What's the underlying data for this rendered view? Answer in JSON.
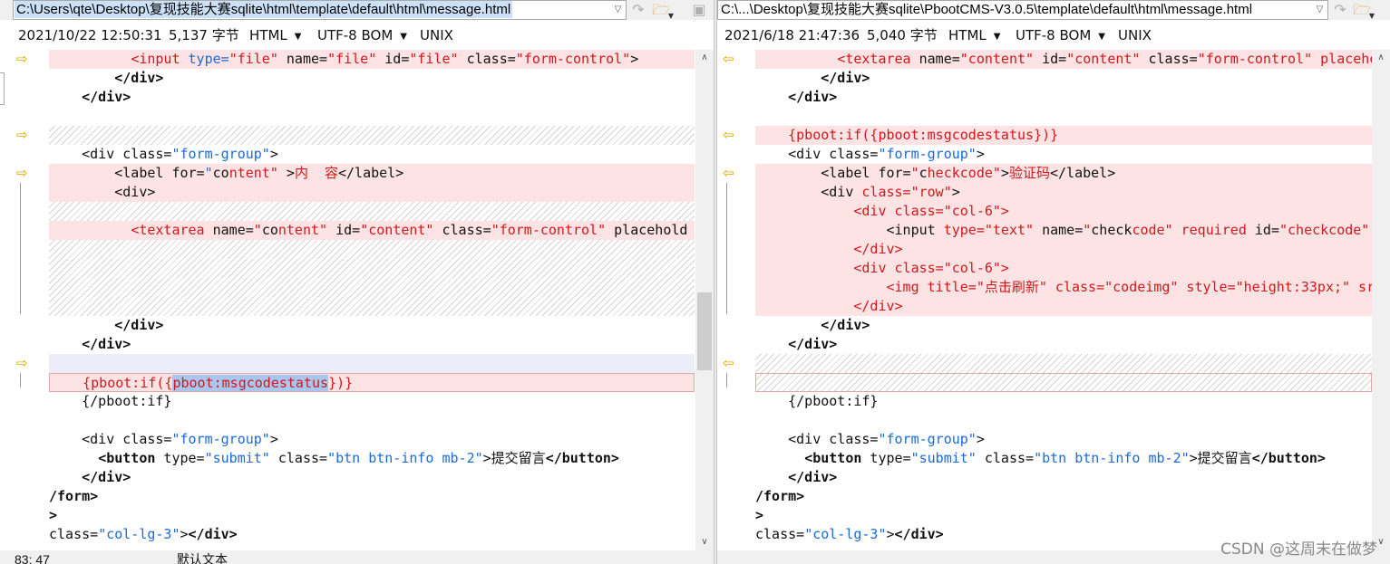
{
  "left": {
    "path": "C:\\Users\\qte\\Desktop\\复现技能大赛sqlite\\html\\template\\default\\html\\message.html",
    "info": {
      "timestamp": "2021/10/22 12:50:31",
      "size": "5,137 字节",
      "syntax": "HTML",
      "encoding": "UTF-8 BOM",
      "line_ending": "UNIX"
    },
    "status": {
      "position": "83: 47",
      "mode": "默认文本"
    }
  },
  "right": {
    "path": "C:\\...\\Desktop\\复现技能大赛sqlite\\PbootCMS-V3.0.5\\template\\default\\html\\message.html",
    "info": {
      "timestamp": "2021/6/18 21:47:36",
      "size": "5,040 字节",
      "syntax": "HTML",
      "encoding": "UTF-8 BOM",
      "line_ending": "UNIX"
    }
  },
  "icons": {
    "arrow_right": "→",
    "arrow_left": "←",
    "combo_arrow": "⌵",
    "dropdown": "▼",
    "up": "∧",
    "down": "∨"
  },
  "watermark": "CSDN @这周末在做梦",
  "colors": {
    "diff_bg": "#fde3e3",
    "tag_red": "#d0181e",
    "attr_blue": "#1b6ad6",
    "selection": "#a8c6ee"
  }
}
